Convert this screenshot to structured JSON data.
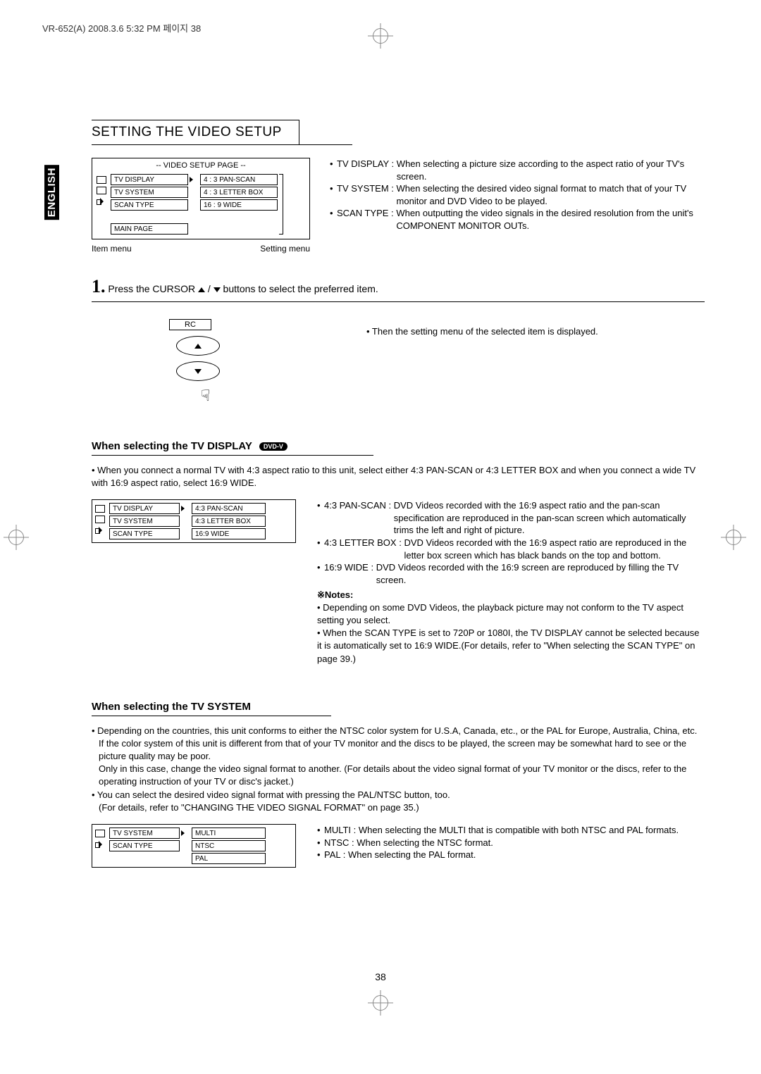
{
  "header_line": "VR-652(A)  2008.3.6  5:32 PM  페이지 38",
  "side_tab": "ENGLISH",
  "section_title": "SETTING THE VIDEO SETUP",
  "menu1": {
    "title": "-- VIDEO  SETUP  PAGE --",
    "items": [
      "TV DISPLAY",
      "TV SYSTEM",
      "SCAN TYPE"
    ],
    "main": "MAIN PAGE",
    "options": [
      "4 : 3 PAN-SCAN",
      "4 : 3 LETTER BOX",
      "16 : 9 WIDE"
    ],
    "item_label": "Item menu",
    "setting_label": "Setting menu"
  },
  "top_desc": {
    "d1_term": "TV DISPLAY :",
    "d1_body": "When selecting a picture size according to the aspect ratio of your TV's screen.",
    "d2_term": "TV SYSTEM :",
    "d2_body": "When selecting the desired video signal format to match that of your TV monitor and DVD Video to be played.",
    "d3_term": "SCAN TYPE :",
    "d3_body": "When outputting the video signals in the desired resolution from the unit's COMPONENT MONITOR OUTs."
  },
  "step1": {
    "pre": "Press the CURSOR ",
    "post": "  buttons to select the preferred item."
  },
  "rc": {
    "label": "RC",
    "text": "• Then the setting menu of the selected item is displayed."
  },
  "tv_display": {
    "heading": "When selecting the TV DISPLAY",
    "badge": "DVD-V",
    "intro": "• When you connect a normal TV with 4:3 aspect ratio to this unit, select either 4:3 PAN-SCAN or 4:3 LETTER BOX  and when you connect a wide TV with 16:9 aspect ratio, select 16:9 WIDE.",
    "menu_items": [
      "TV DISPLAY",
      "TV SYSTEM",
      "SCAN TYPE"
    ],
    "menu_options": [
      "4:3 PAN-SCAN",
      "4:3 LETTER BOX",
      "16:9 WIDE"
    ],
    "o1_term": "4:3 PAN-SCAN :",
    "o1_body": "DVD Videos recorded with the 16:9 aspect ratio and the pan-scan specification are reproduced in the pan-scan screen which automatically trims the left and right of picture.",
    "o2_term": "4:3 LETTER BOX :",
    "o2_body": "DVD Videos recorded with the 16:9 aspect ratio are reproduced in the letter box screen which has black bands on the top and bottom.",
    "o3_term": "16:9 WIDE :",
    "o3_body": "DVD Videos recorded with the 16:9 screen are reproduced by filling the TV screen.",
    "notes_label": "Notes:",
    "note1": "• Depending on some DVD Videos, the playback picture may not conform to the TV aspect setting you select.",
    "note2": "• When the SCAN TYPE is set to 720P or 1080I, the TV DISPLAY cannot be selected because it is automatically set to 16:9 WIDE.(For details, refer to \"When selecting the SCAN TYPE\" on page 39.)"
  },
  "tv_system": {
    "heading": "When selecting the TV SYSTEM",
    "p1": "• Depending on the countries, this unit conforms to either the NTSC color system for U.S.A, Canada, etc., or the PAL for Europe, Australia, China, etc.",
    "p1b": "If the color system of this unit is different from that of your TV monitor and the discs to be played, the screen may be somewhat hard to see or the picture quality may be poor.",
    "p1c": "Only in this case, change the video signal format to another. (For details about the video signal format of your TV monitor or the discs, refer to the operating instruction of your TV or disc's jacket.)",
    "p2": "• You can select the desired video signal format with pressing the PAL/NTSC button, too.",
    "p2b": "(For details, refer to \"CHANGING THE VIDEO SIGNAL FORMAT\" on page 35.)",
    "menu_items": [
      "TV SYSTEM",
      "SCAN TYPE"
    ],
    "menu_options": [
      "MULTI",
      "NTSC",
      "PAL"
    ],
    "o1_term": "MULTI :",
    "o1_body": "When selecting the MULTI that is compatible with both NTSC and PAL formats.",
    "o2_term": "NTSC :",
    "o2_body": "When selecting the NTSC format.",
    "o3_term": "PAL :",
    "o3_body": "When selecting the PAL format."
  },
  "page_number": "38"
}
